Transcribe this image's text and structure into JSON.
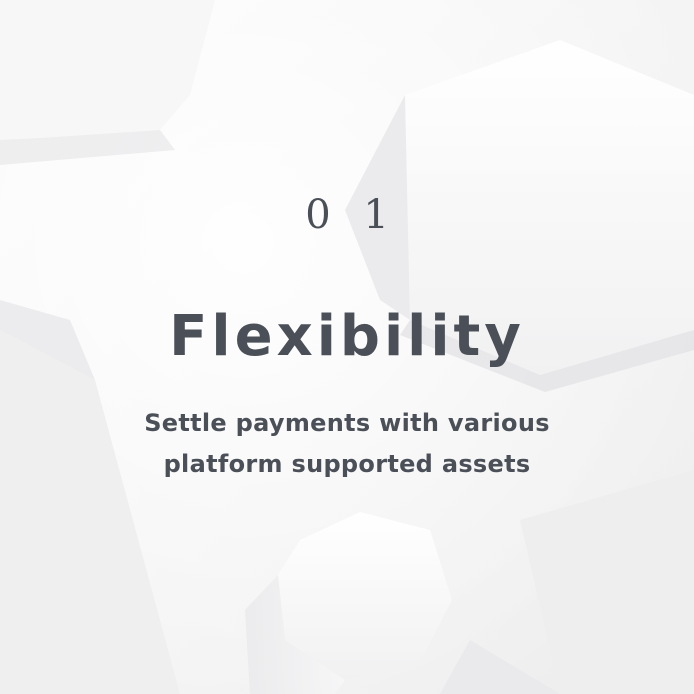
{
  "feature": {
    "number": "0 1",
    "title": "Flexibility",
    "description_lines": [
      "Settle payments with various",
      "platform supported assets"
    ]
  },
  "colors": {
    "background": "#f3f3f4",
    "text": "#4b5058"
  }
}
